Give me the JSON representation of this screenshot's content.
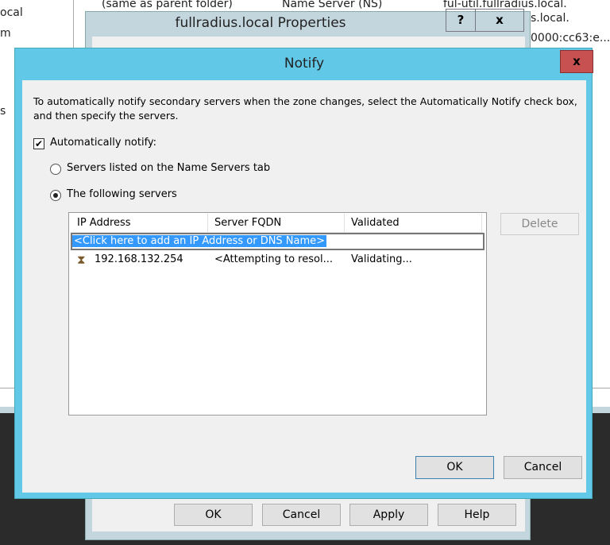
{
  "background": {
    "left_texts": [
      "ocal",
      "m",
      "s"
    ],
    "list_row": {
      "name": "(same as parent folder)",
      "type": "Name Server (NS)",
      "data": "ful-util.fullradius.local."
    },
    "right_texts": [
      "s.local.",
      "0000:cc63:e..."
    ]
  },
  "properties": {
    "title": "fullradius.local Properties",
    "help_label": "?",
    "close_label": "x",
    "buttons": {
      "ok": "OK",
      "cancel": "Cancel",
      "apply": "Apply",
      "help": "Help"
    }
  },
  "notify": {
    "title": "Notify",
    "close_label": "x",
    "description": "To automatically notify secondary servers when the zone changes, select the Automatically Notify check box, and then specify the servers.",
    "auto_notify": {
      "label": "Automatically notify:",
      "checked": true
    },
    "radio_ns": {
      "label": "Servers listed on the Name Servers tab",
      "selected": false
    },
    "radio_following": {
      "label": "The following servers",
      "selected": true
    },
    "table": {
      "columns": [
        "IP Address",
        "Server FQDN",
        "Validated"
      ],
      "add_row": "<Click here to add an IP Address or DNS Name>",
      "rows": [
        {
          "icon": "hourglass-icon",
          "ip": "192.168.132.254",
          "fqdn": "<Attempting to resol...",
          "validated": "Validating..."
        }
      ]
    },
    "delete_label": "Delete",
    "ok_label": "OK",
    "cancel_label": "Cancel"
  },
  "colors": {
    "accent": "#62c8e8",
    "close": "#c75050",
    "selection": "#3399ff"
  }
}
